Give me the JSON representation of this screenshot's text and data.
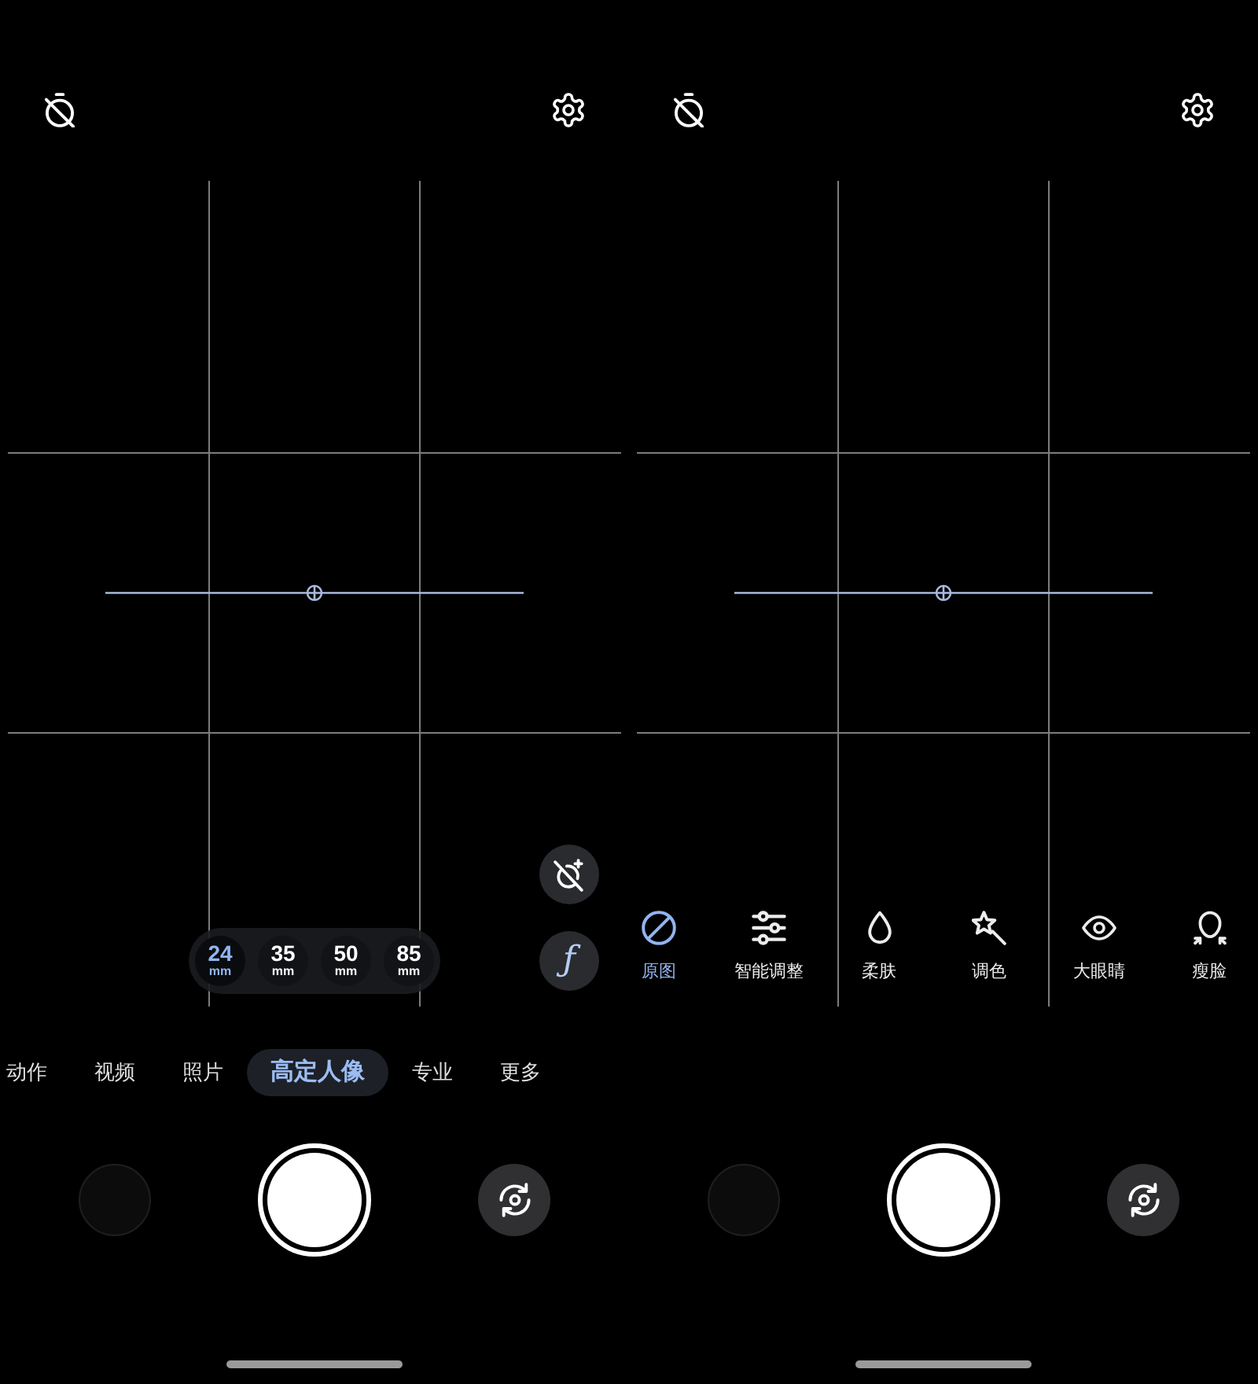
{
  "screens": [
    {
      "side_buttons": [
        {
          "kind": "icon"
        },
        {
          "kind": "text",
          "label": "ƒ"
        }
      ],
      "focal_lengths": [
        {
          "value": "24",
          "unit": "mm",
          "selected": true
        },
        {
          "value": "35",
          "unit": "mm",
          "selected": false
        },
        {
          "value": "50",
          "unit": "mm",
          "selected": false
        },
        {
          "value": "85",
          "unit": "mm",
          "selected": false
        }
      ],
      "modes": [
        {
          "label": "动作",
          "selected": false
        },
        {
          "label": "视频",
          "selected": false
        },
        {
          "label": "照片",
          "selected": false
        },
        {
          "label": "高定人像",
          "selected": true
        },
        {
          "label": "专业",
          "selected": false
        },
        {
          "label": "更多",
          "selected": false
        }
      ]
    },
    {
      "beauty_options": [
        {
          "label": "原图",
          "selected": true
        },
        {
          "label": "智能调整",
          "selected": false
        },
        {
          "label": "柔肤",
          "selected": false
        },
        {
          "label": "调色",
          "selected": false
        },
        {
          "label": "大眼睛",
          "selected": false
        },
        {
          "label": "瘦脸",
          "selected": false
        }
      ]
    }
  ]
}
